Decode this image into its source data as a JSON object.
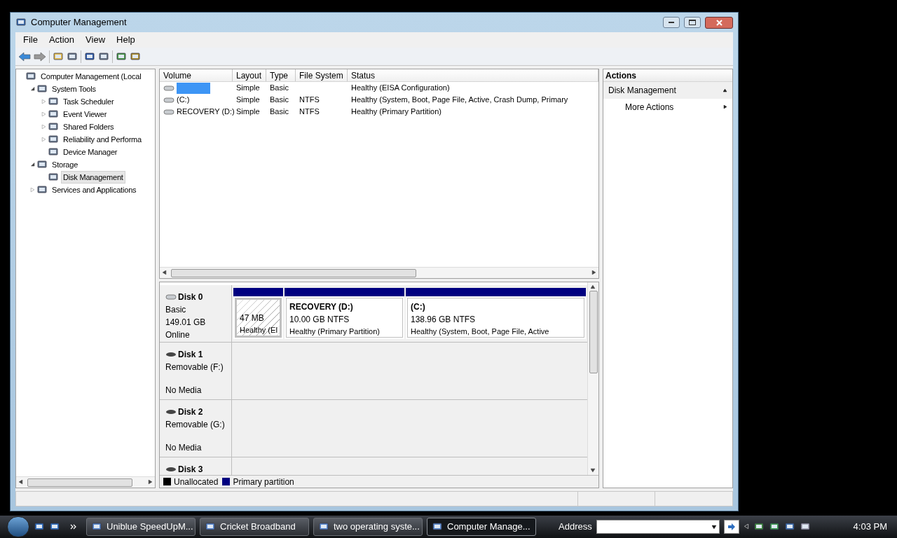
{
  "window": {
    "title": "Computer Management"
  },
  "menu": [
    "File",
    "Action",
    "View",
    "Help"
  ],
  "tree": [
    {
      "label": "Computer Management (Local",
      "kind": "root",
      "selected": false,
      "children": [
        {
          "label": "System Tools",
          "kind": "branch",
          "expanded": true,
          "selected": false,
          "children": [
            {
              "label": "Task Scheduler",
              "kind": "branch",
              "expanded": false,
              "selected": false
            },
            {
              "label": "Event Viewer",
              "kind": "branch",
              "expanded": false,
              "selected": false
            },
            {
              "label": "Shared Folders",
              "kind": "branch",
              "expanded": false,
              "selected": false
            },
            {
              "label": "Reliability and Performa",
              "kind": "branch",
              "expanded": false,
              "selected": false
            },
            {
              "label": "Device Manager",
              "kind": "leaf",
              "selected": false
            }
          ]
        },
        {
          "label": "Storage",
          "kind": "branch",
          "expanded": true,
          "selected": false,
          "children": [
            {
              "label": "Disk Management",
              "kind": "leaf",
              "selected": true
            }
          ]
        },
        {
          "label": "Services and Applications",
          "kind": "branch",
          "expanded": false,
          "selected": false
        }
      ]
    }
  ],
  "volume_table": {
    "columns": [
      "Volume",
      "Layout",
      "Type",
      "File System",
      "Status"
    ],
    "rows": [
      {
        "redacted": true,
        "layout": "Simple",
        "type": "Basic",
        "status": "Healthy (EISA Configuration)"
      },
      {
        "volume": "(C:)",
        "redacted": false,
        "layout": "Simple",
        "type": "Basic",
        "file_system": "NTFS",
        "status": "Healthy (System, Boot, Page File, Active, Crash Dump, Primary"
      },
      {
        "volume": "RECOVERY (D:)",
        "redacted": false,
        "layout": "Simple",
        "type": "Basic",
        "file_system": "NTFS",
        "status": "Healthy (Primary Partition)"
      }
    ]
  },
  "disks": [
    {
      "name": "Disk 0",
      "kind": "fixed",
      "lines": [
        "Basic",
        "149.01 GB",
        "Online"
      ],
      "partitions": [
        {
          "size": "47 MB",
          "status": "Healthy (EI",
          "selected": true
        },
        {
          "title": "RECOVERY  (D:)",
          "size": "10.00 GB NTFS",
          "status": "Healthy (Primary Partition)",
          "selected": false
        },
        {
          "title": "(C:)",
          "size": "138.96 GB NTFS",
          "status": "Healthy (System, Boot, Page File, Active",
          "selected": false
        }
      ]
    },
    {
      "name": "Disk 1",
      "kind": "removable",
      "lines": [
        "Removable (F:)",
        "No Media"
      ]
    },
    {
      "name": "Disk 2",
      "kind": "removable",
      "lines": [
        "Removable (G:)",
        "No Media"
      ]
    },
    {
      "name": "Disk 3",
      "kind": "removable"
    }
  ],
  "legend": [
    {
      "label": "Unallocated",
      "color": "#000000"
    },
    {
      "label": "Primary partition",
      "color": "#000080"
    }
  ],
  "actions": {
    "header": "Actions",
    "section": "Disk Management",
    "items": [
      "More Actions"
    ]
  },
  "taskbar": {
    "buttons": [
      {
        "label": "Uniblue SpeedUpM...",
        "selected": false
      },
      {
        "label": "Cricket Broadband",
        "selected": false
      },
      {
        "label": "two operating syste...",
        "selected": false
      },
      {
        "label": "Computer Manage...",
        "selected": true
      }
    ],
    "address_label": "Address",
    "time": "4:03 PM"
  }
}
